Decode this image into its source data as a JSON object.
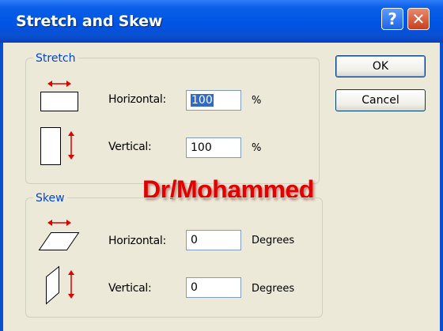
{
  "window": {
    "title": "Stretch and Skew",
    "help_glyph": "?",
    "close_glyph": "✕"
  },
  "stretch": {
    "legend": "Stretch",
    "horizontal_label": "Horizontal:",
    "horizontal_value": "100",
    "horizontal_unit": "%",
    "vertical_label": "Vertical:",
    "vertical_value": "100",
    "vertical_unit": "%"
  },
  "skew": {
    "legend": "Skew",
    "horizontal_label": "Horizontal:",
    "horizontal_value": "0",
    "horizontal_unit": "Degrees",
    "vertical_label": "Vertical:",
    "vertical_value": "0",
    "vertical_unit": "Degrees"
  },
  "buttons": {
    "ok": "OK",
    "cancel": "Cancel"
  },
  "watermark": "Dr/Mohammed",
  "colors": {
    "titlebar": "#0054e3",
    "legend_text": "#0046d5",
    "arrow": "#e00000",
    "watermark": "#e00000"
  }
}
